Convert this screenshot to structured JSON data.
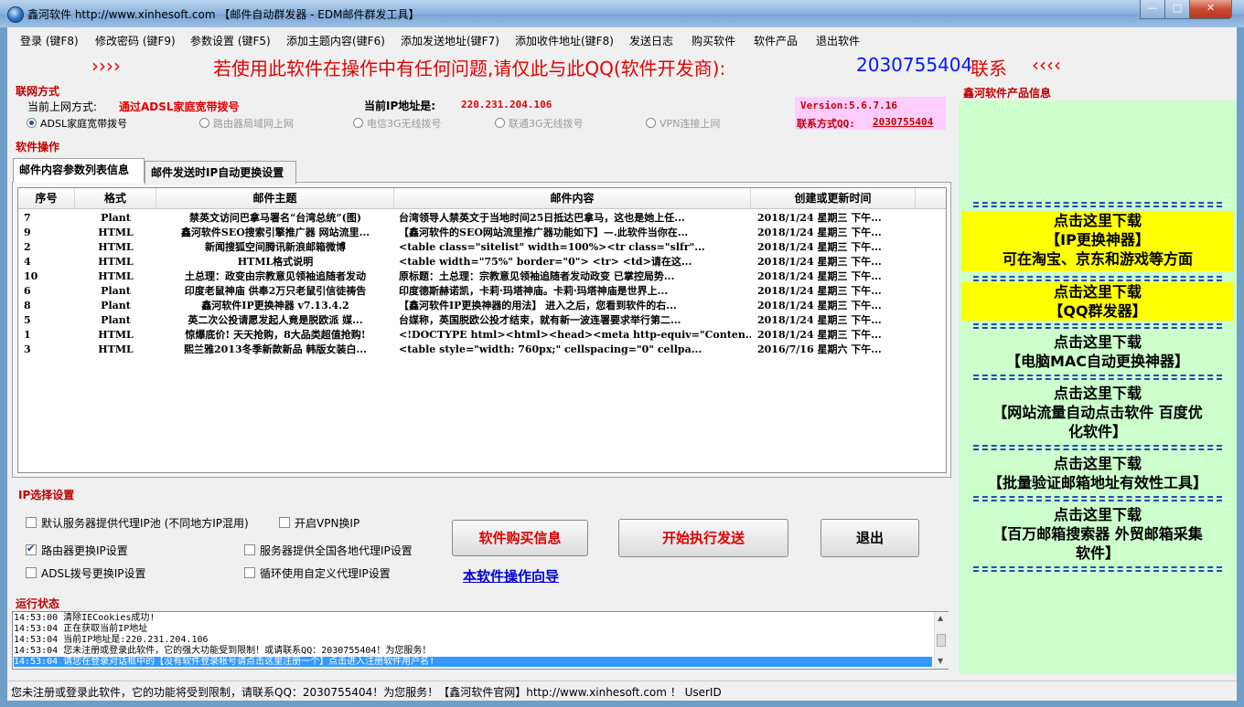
{
  "window": {
    "title": "鑫河软件 http://www.xinhesoft.com 【邮件自动群发器 - EDM邮件群发工具】",
    "buttons": [
      "—",
      "□",
      "✕"
    ]
  },
  "menu": [
    "登录 (键F8)",
    "修改密码 (键F9)",
    "参数设置 (键F5)",
    "添加主题内容(键F6)",
    "添加发送地址(键F7)",
    "添加收件地址(键F8)",
    "发送日志",
    "购买软件",
    "软件产品",
    "退出软件"
  ],
  "banner": {
    "left_arrows": "››››",
    "text": "若使用此软件在操作中有任何问题,请仅此与此QQ(软件开发商):",
    "qq": "2030755404",
    "suffix": "联系",
    "right_arrows": "‹‹‹‹"
  },
  "network": {
    "section_title": "联网方式",
    "current_label": "当前上网方式:",
    "current_value": "通过ADSL家庭宽带拨号",
    "ip_label": "当前IP地址是:",
    "ip_value": "220.231.204.106",
    "options": [
      {
        "label": "ADSL家庭宽带拨号",
        "checked": true
      },
      {
        "label": "路由器局域网上网",
        "checked": false
      },
      {
        "label": "电信3G无线拨号",
        "checked": false
      },
      {
        "label": "联通3G无线拨号",
        "checked": false
      },
      {
        "label": "VPN连接上网",
        "checked": false
      }
    ],
    "version": "Version:5.6.7.16",
    "contact_label": "联系方式QQ:",
    "contact_qq": "2030755404"
  },
  "software_ops": {
    "section_title": "软件操作",
    "tabs": [
      "邮件内容参数列表信息",
      "邮件发送时IP自动更换设置"
    ],
    "columns": [
      "序号",
      "格式",
      "邮件主题",
      "邮件内容",
      "创建或更新时间"
    ],
    "rows": [
      {
        "id": "7",
        "format": "Plant",
        "subject": "禁英文访问巴拿马署名“台湾总统”(图)",
        "content": "台湾领导人禁英文于当地时间25日抵达巴拿马，这也是她上任...",
        "time": "2018/1/24 星期三 下午..."
      },
      {
        "id": "9",
        "format": "HTML",
        "subject": "鑫河软件SEO搜索引擎推广器 网站流里...",
        "content": "【鑫河软件的SEO网站流里推广器功能如下】—.此软件当你在...",
        "time": "2018/1/24 星期三 下午..."
      },
      {
        "id": "2",
        "format": "HTML",
        "subject": "新闻搜狐空间腾讯新浪邮箱微博",
        "content": "<table class=\"sitelist\" width=100%><tr class=\"slfr\"...",
        "time": "2018/1/24 星期三 下午..."
      },
      {
        "id": "4",
        "format": "HTML",
        "subject": "HTML格式说明",
        "content": "<table width=\"75%\" border=\"0\"> <tr>   <td>请在这...",
        "time": "2018/1/24 星期三 下午..."
      },
      {
        "id": "10",
        "format": "HTML",
        "subject": "土总理：政变由宗教意见领袖追随者发动",
        "content": "原标题：土总理：宗教意见领袖追随者发动政变 已掌控局势...",
        "time": "2018/1/24 星期三 下午..."
      },
      {
        "id": "6",
        "format": "Plant",
        "subject": "印度老鼠神庙 供奉2万只老鼠引信徒祷告",
        "content": "印度德斯赫诺凯，卡莉·玛塔神庙。卡莉·玛塔神庙是世界上...",
        "time": "2018/1/24 星期三 下午..."
      },
      {
        "id": "8",
        "format": "Plant",
        "subject": "鑫河软件IP更换神器 v7.13.4.2",
        "content": "【鑫河软件IP更换神器的用法】 进入之后，您看到软件的右...",
        "time": "2018/1/24 星期三 下午..."
      },
      {
        "id": "5",
        "format": "Plant",
        "subject": "英二次公投请愿发起人竟是脱欧派 媒...",
        "content": "台媒称，英国脱欧公投才结束，就有新一波连署要求举行第二...",
        "time": "2018/1/24 星期三 下午..."
      },
      {
        "id": "1",
        "format": "HTML",
        "subject": "惊爆底价! 天天抢购，8大品类超值抢购!",
        "content": "<!DOCTYPE html><html><head><meta http-equiv=\"Conten...",
        "time": "2018/1/24 星期三 下午..."
      },
      {
        "id": "3",
        "format": "HTML",
        "subject": "熙兰雅2013冬季新款新品 韩版女装白...",
        "content": "<table style=\"width: 760px;\" cellspacing=\"0\" cellpa...",
        "time": "2016/7/16 星期六 下午..."
      }
    ]
  },
  "ip_settings": {
    "section_title": "IP选择设置",
    "checkboxes": [
      {
        "label": "默认服务器提供代理IP池 (不同地方IP混用)",
        "checked": false
      },
      {
        "label": "开启VPN换IP",
        "checked": false
      },
      {
        "label": "路由器更换IP设置",
        "checked": true
      },
      {
        "label": "服务器提供全国各地代理IP设置",
        "checked": false
      },
      {
        "label": "ADSL拨号更换IP设置",
        "checked": false
      },
      {
        "label": "循环使用自定义代理IP设置",
        "checked": false
      }
    ],
    "buy_button": "软件购买信息",
    "start_button": "开始执行发送",
    "exit_button": "退出",
    "guide_link": "本软件操作向导"
  },
  "run_status": {
    "section_title": "运行状态",
    "lines": [
      "14:53:00 清除IECookies成功!",
      "14:53:04 正在获取当前IP地址",
      "14:53:04 当前IP地址是:220.231.204.106",
      "14:53:04 您未注册或登录此软件，它的强大功能受到限制！或请联系QQ：2030755404！为您服务！",
      "14:53:04 请您在登录对话框中的【没有软件登录帐号请点击这里注册一个】点击进入注册软件用户名!"
    ]
  },
  "statusbar": "您未注册或登录此软件，它的功能将受到限制，请联系QQ：2030755404！为您服务！【鑫河软件官网】http://www.xinhesoft.com ！  UserID",
  "products": {
    "section_title": "鑫河软件产品信息",
    "items": [
      {
        "lines": [
          "点击这里下载",
          "【IP更换神器】",
          "可在淘宝、京东和游戏等方面"
        ],
        "highlight": true
      },
      {
        "lines": [
          "点击这里下载",
          "【QQ群发器】"
        ],
        "highlight": true
      },
      {
        "lines": [
          "点击这里下载",
          "【电脑MAC自动更换神器】"
        ],
        "highlight": false
      },
      {
        "lines": [
          "点击这里下载",
          "【网站流量自动点击软件 百度优",
          "化软件】"
        ],
        "highlight": false
      },
      {
        "lines": [
          "点击这里下载",
          "【批量验证邮箱地址有效性工具】"
        ],
        "highlight": false
      },
      {
        "lines": [
          "点击这里下载",
          "【百万邮箱搜索器 外贸邮箱采集",
          "软件】"
        ],
        "highlight": false
      }
    ]
  }
}
